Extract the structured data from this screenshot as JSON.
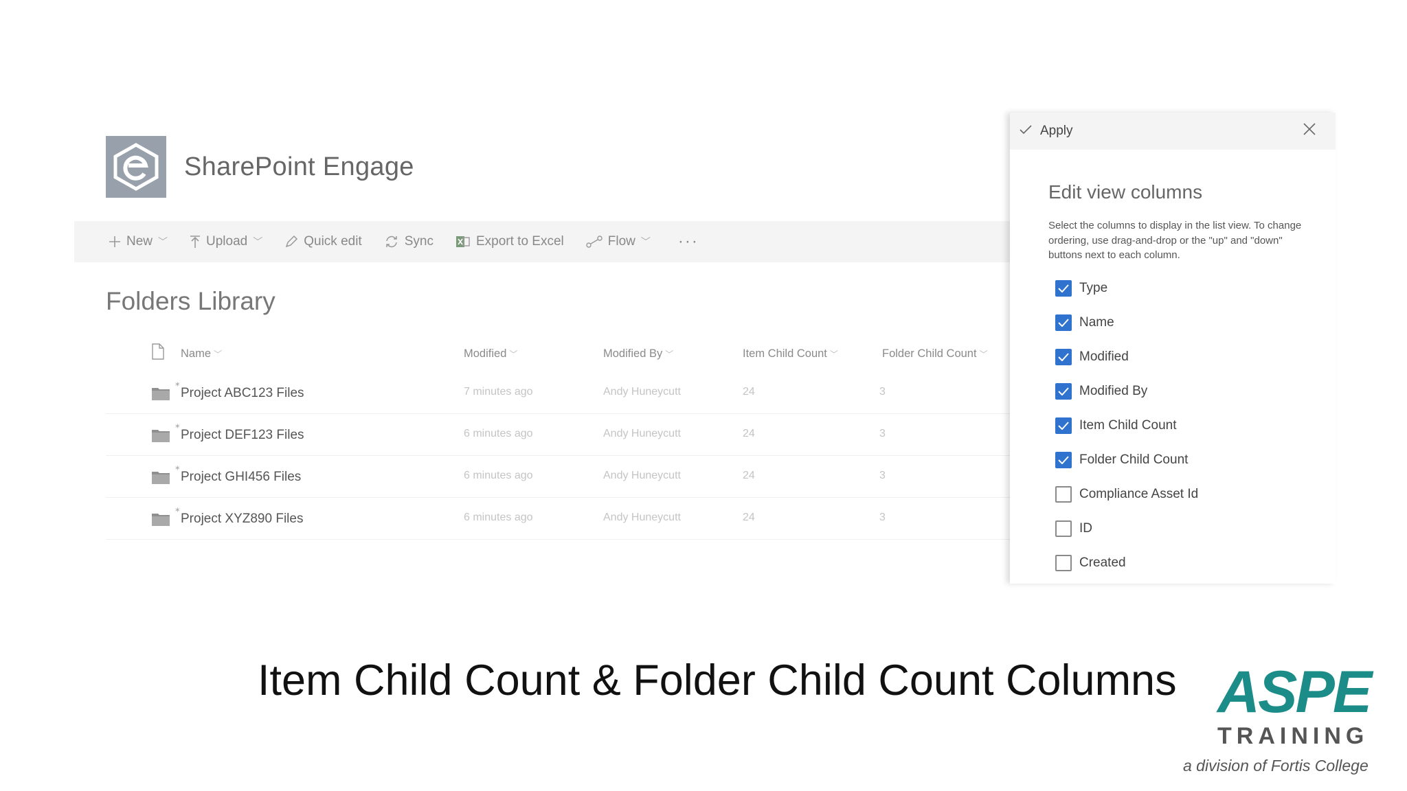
{
  "site": {
    "title": "SharePoint Engage"
  },
  "command_bar": {
    "items": [
      {
        "label": "New",
        "icon": "plus-icon",
        "has_dropdown": true
      },
      {
        "label": "Upload",
        "icon": "upload-icon",
        "has_dropdown": true
      },
      {
        "label": "Quick edit",
        "icon": "pencil-icon",
        "has_dropdown": false
      },
      {
        "label": "Sync",
        "icon": "sync-icon",
        "has_dropdown": false
      },
      {
        "label": "Export to Excel",
        "icon": "excel-icon",
        "has_dropdown": false
      },
      {
        "label": "Flow",
        "icon": "flow-icon",
        "has_dropdown": true
      }
    ],
    "more_label": "···"
  },
  "library": {
    "title": "Folders Library",
    "columns": {
      "name": "Name",
      "modified": "Modified",
      "modified_by": "Modified By",
      "item_child_count": "Item Child Count",
      "folder_child_count": "Folder Child Count"
    },
    "rows": [
      {
        "name": "Project ABC123 Files",
        "modified": "7 minutes ago",
        "modified_by": "Andy Huneycutt",
        "item_child_count": "24",
        "folder_child_count": "3"
      },
      {
        "name": "Project DEF123 Files",
        "modified": "6 minutes ago",
        "modified_by": "Andy Huneycutt",
        "item_child_count": "24",
        "folder_child_count": "3"
      },
      {
        "name": "Project GHI456 Files",
        "modified": "6 minutes ago",
        "modified_by": "Andy Huneycutt",
        "item_child_count": "24",
        "folder_child_count": "3"
      },
      {
        "name": "Project XYZ890 Files",
        "modified": "6 minutes ago",
        "modified_by": "Andy Huneycutt",
        "item_child_count": "24",
        "folder_child_count": "3"
      }
    ]
  },
  "panel": {
    "apply_label": "Apply",
    "title": "Edit view columns",
    "description": "Select the columns to display in the list view. To change ordering, use drag-and-drop or the \"up\" and \"down\" buttons next to each column.",
    "columns": [
      {
        "label": "Type",
        "checked": true
      },
      {
        "label": "Name",
        "checked": true
      },
      {
        "label": "Modified",
        "checked": true
      },
      {
        "label": "Modified By",
        "checked": true
      },
      {
        "label": "Item Child Count",
        "checked": true
      },
      {
        "label": "Folder Child Count",
        "checked": true
      },
      {
        "label": "Compliance Asset Id",
        "checked": false
      },
      {
        "label": "ID",
        "checked": false
      },
      {
        "label": "Created",
        "checked": false
      }
    ]
  },
  "slide": {
    "title": "Item Child Count & Folder Child Count Columns",
    "logo_brand": "ASPE",
    "logo_sub": "TRAINING",
    "logo_tagline": "a division of Fortis College"
  },
  "colors": {
    "accent_blue": "#2f73cf",
    "aspe_teal": "#1c8c88",
    "command_bar_bg": "#f4f4f4"
  }
}
